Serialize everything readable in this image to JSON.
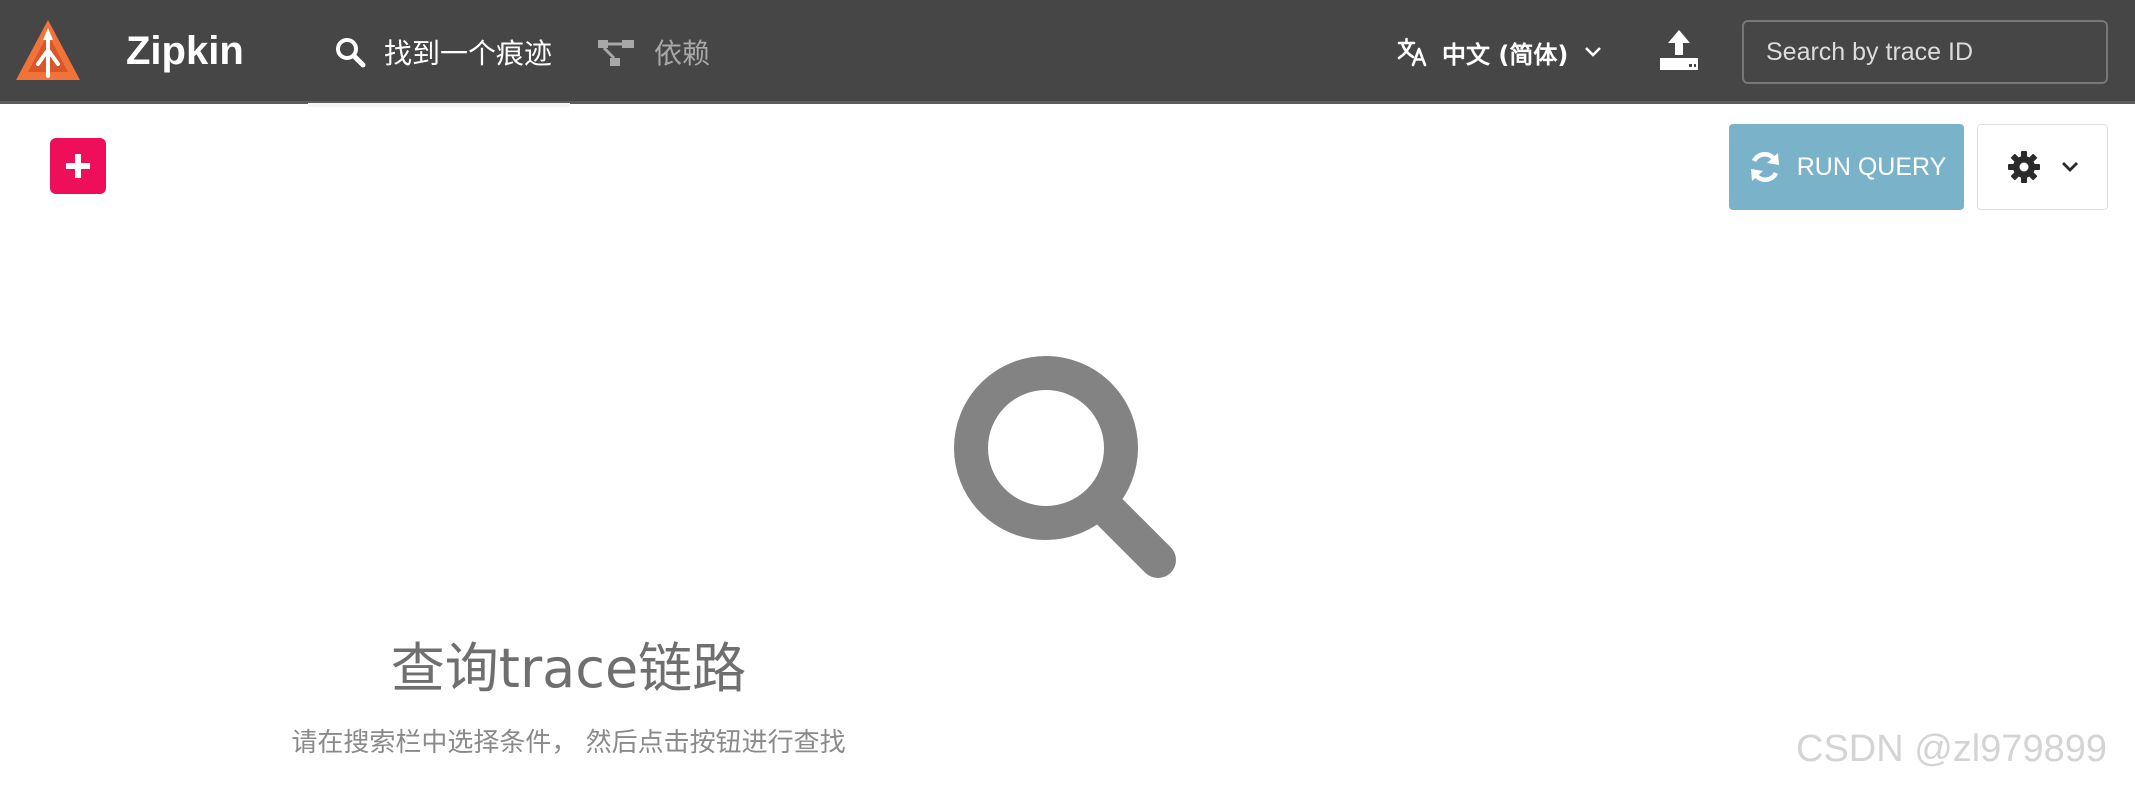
{
  "header": {
    "brand": "Zipkin",
    "tabs": [
      {
        "label": "找到一个痕迹",
        "icon": "search-icon",
        "active": true
      },
      {
        "label": "依赖",
        "icon": "dependencies-icon",
        "active": false
      }
    ],
    "language": {
      "label": "中文 (简体)",
      "icon": "translate-icon"
    },
    "upload_icon": "upload-icon",
    "search": {
      "placeholder": "Search by trace ID",
      "value": ""
    }
  },
  "toolbar": {
    "add_icon": "plus-icon",
    "run_query_label": "RUN QUERY",
    "settings_icon": "gear-icon"
  },
  "empty_state": {
    "icon": "search-icon",
    "title": "查询trace链路",
    "subtitle": "请在搜索栏中选择条件， 然后点击按钮进行查找"
  },
  "watermark": "CSDN @zl979899",
  "colors": {
    "header_bg": "#464646",
    "add_button": "#ee0e59",
    "run_button": "#7ab3c9",
    "logo": "#f2733a",
    "empty_icon": "#838383"
  }
}
